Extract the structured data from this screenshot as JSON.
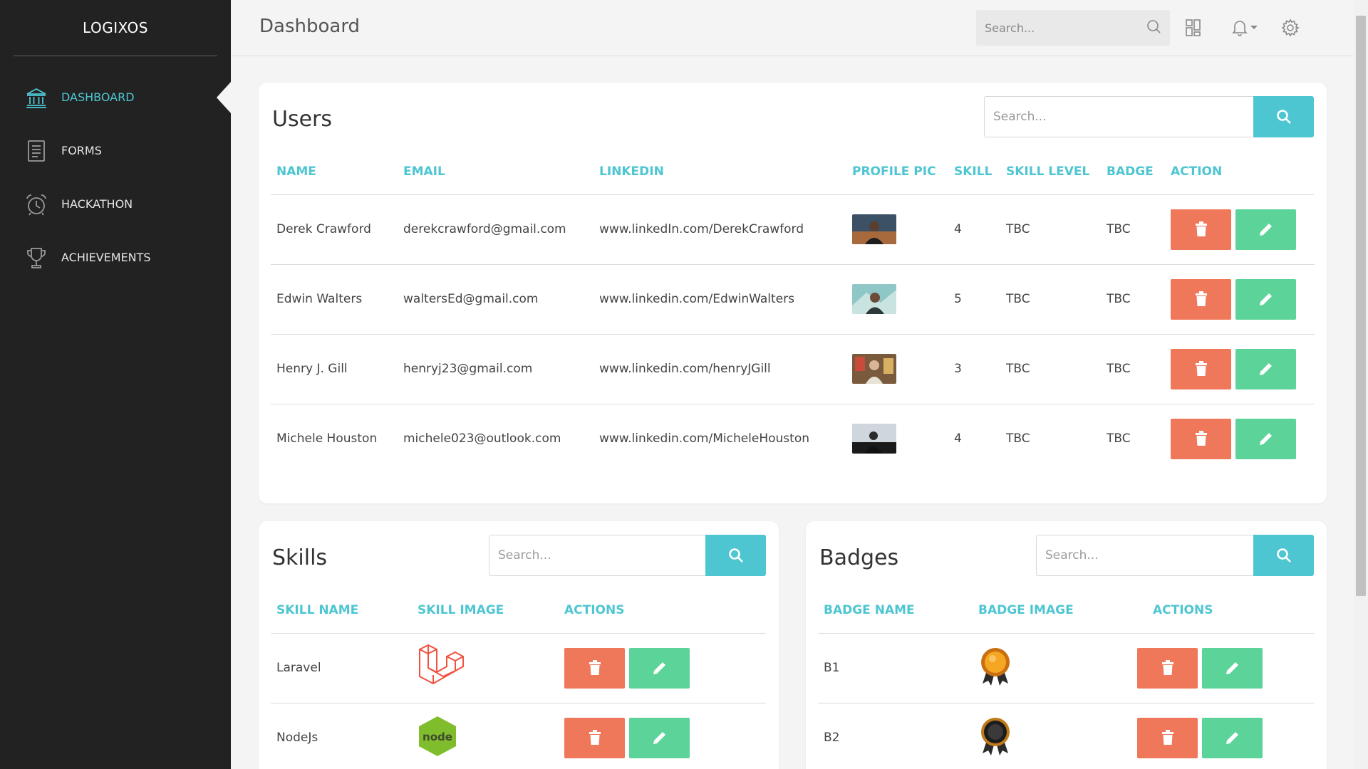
{
  "brand": "LOGIXOS",
  "sidebar": {
    "items": [
      {
        "label": "DASHBOARD",
        "icon": "bank-icon",
        "active": true
      },
      {
        "label": "FORMS",
        "icon": "document-icon",
        "active": false
      },
      {
        "label": "HACKATHON",
        "icon": "alarm-clock-icon",
        "active": false
      },
      {
        "label": "ACHIEVEMENTS",
        "icon": "trophy-icon",
        "active": false
      }
    ]
  },
  "topbar": {
    "title": "Dashboard",
    "search_placeholder": "Search...",
    "icons": [
      "search-icon",
      "layout-grid-icon",
      "bell-icon",
      "caret-down-icon",
      "gear-icon"
    ]
  },
  "users": {
    "title": "Users",
    "search_placeholder": "Search...",
    "columns": [
      "NAME",
      "EMAIL",
      "LINKEDIN",
      "PROFILE PIC",
      "SKILL",
      "SKILL LEVEL",
      "BADGE",
      "ACTION"
    ],
    "rows": [
      {
        "name": "Derek Crawford",
        "email": "derekcrawford@gmail.com",
        "linkedin": "www.linkedIn.com/DerekCrawford",
        "skill": "4",
        "skill_level": "TBC",
        "badge": "TBC"
      },
      {
        "name": "Edwin Walters",
        "email": "waltersEd@gmail.com",
        "linkedin": "www.linkedin.com/EdwinWalters",
        "skill": "5",
        "skill_level": "TBC",
        "badge": "TBC"
      },
      {
        "name": "Henry J. Gill",
        "email": "henryj23@gmail.com",
        "linkedin": "www.linkedin.com/henryJGill",
        "skill": "3",
        "skill_level": "TBC",
        "badge": "TBC"
      },
      {
        "name": "Michele Houston",
        "email": "michele023@outlook.com",
        "linkedin": "www.linkedin.com/MicheleHouston",
        "skill": "4",
        "skill_level": "TBC",
        "badge": "TBC"
      }
    ]
  },
  "skills": {
    "title": "Skills",
    "search_placeholder": "Search...",
    "columns": [
      "SKILL NAME",
      "SKILL IMAGE",
      "ACTIONS"
    ],
    "rows": [
      {
        "name": "Laravel",
        "image": "laravel-logo"
      },
      {
        "name": "NodeJs",
        "image": "nodejs-logo",
        "image_text": "node"
      }
    ]
  },
  "badges": {
    "title": "Badges",
    "search_placeholder": "Search...",
    "columns": [
      "BADGE NAME",
      "BADGE IMAGE",
      "ACTIONS"
    ],
    "rows": [
      {
        "name": "B1",
        "image": "gold-medal-icon"
      },
      {
        "name": "B2",
        "image": "black-medal-icon"
      }
    ]
  },
  "colors": {
    "accent": "#4ec6d2",
    "sidebar_bg": "#222222",
    "delete": "#f0785a",
    "edit": "#5cd398"
  }
}
